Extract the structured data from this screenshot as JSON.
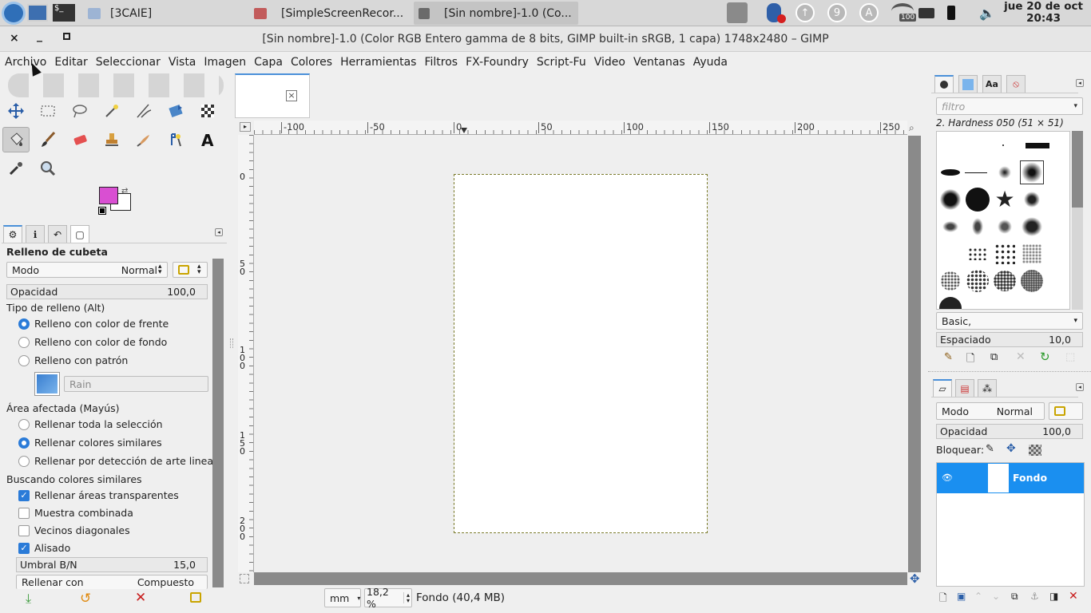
{
  "taskbar": {
    "tasks": [
      {
        "label": "[3CAIE]",
        "icon": "folder-icon"
      },
      {
        "label": "[SimpleScreenRecor...",
        "icon": "video-recorder-icon"
      },
      {
        "label": "[Sin nombre]-1.0 (Co...",
        "icon": "gimp-icon",
        "active": true
      }
    ],
    "tray": {
      "badge_9": "9",
      "badge_a": "A",
      "wifi_level": "100"
    },
    "clock": {
      "date": "jue 20 de oct",
      "time": "20:43"
    }
  },
  "window": {
    "title": "[Sin nombre]-1.0 (Color RGB Entero gamma de 8 bits, GIMP built-in sRGB, 1 capa) 1748x2480 – GIMP",
    "close": "×",
    "minimize": "_",
    "maximize": "▫"
  },
  "menu": [
    "Archivo",
    "Editar",
    "Seleccionar",
    "Vista",
    "Imagen",
    "Capa",
    "Colores",
    "Herramientas",
    "Filtros",
    "FX-Foundry",
    "Script-Fu",
    "Video",
    "Ventanas",
    "Ayuda"
  ],
  "colors": {
    "foreground": "#d94fd2",
    "background": "#ffffff",
    "accent": "#2a7bd8",
    "layer_selected": "#1a8ff0"
  },
  "tool_options": {
    "title": "Relleno de cubeta",
    "mode_label": "Modo",
    "mode_value": "Normal",
    "opacity_label": "Opacidad",
    "opacity_value": "100,0",
    "fill_type_label": "Tipo de relleno  (Alt)",
    "fill_fg": "Relleno con color de frente",
    "fill_bg": "Relleno con color de fondo",
    "fill_pattern": "Relleno con patrón",
    "pattern_name": "Rain",
    "area_label": "Área afectada  (Mayús)",
    "area_all": "Rellenar toda la selección",
    "area_similar": "Rellenar colores similares",
    "area_lineart": "Rellenar por detección de arte lineal",
    "similar_label": "Buscando colores similares",
    "chk_transparent": "Rellenar áreas transparentes",
    "chk_merged": "Muestra combinada",
    "chk_diagonal": "Vecinos diagonales",
    "chk_antialias": "Alisado",
    "threshold_label": "Umbral B/N",
    "threshold_value": "15,0",
    "fill_with_label": "Rellenar con",
    "fill_with_value": "Compuesto"
  },
  "rulers": {
    "h_ticks": [
      "-100",
      "-50",
      "0",
      "50",
      "100",
      "150",
      "200",
      "250"
    ],
    "v_ticks": [
      [
        "0"
      ],
      [
        "5",
        "0"
      ],
      [
        "1",
        "0",
        "0"
      ],
      [
        "1",
        "5",
        "0"
      ],
      [
        "2",
        "0",
        "0"
      ]
    ]
  },
  "status": {
    "unit": "mm",
    "zoom": "18,2 %",
    "info": "Fondo (40,4 MB)"
  },
  "brushes": {
    "filter_placeholder": "filtro",
    "current": "2. Hardness 050 (51 × 51)",
    "tag": "Basic,",
    "spacing_label": "Espaciado",
    "spacing_value": "10,0"
  },
  "layers": {
    "mode_label": "Modo",
    "mode_value": "Normal",
    "opacity_label": "Opacidad",
    "opacity_value": "100,0",
    "lock_label": "Bloquear:",
    "items": [
      {
        "name": "Fondo"
      }
    ]
  }
}
